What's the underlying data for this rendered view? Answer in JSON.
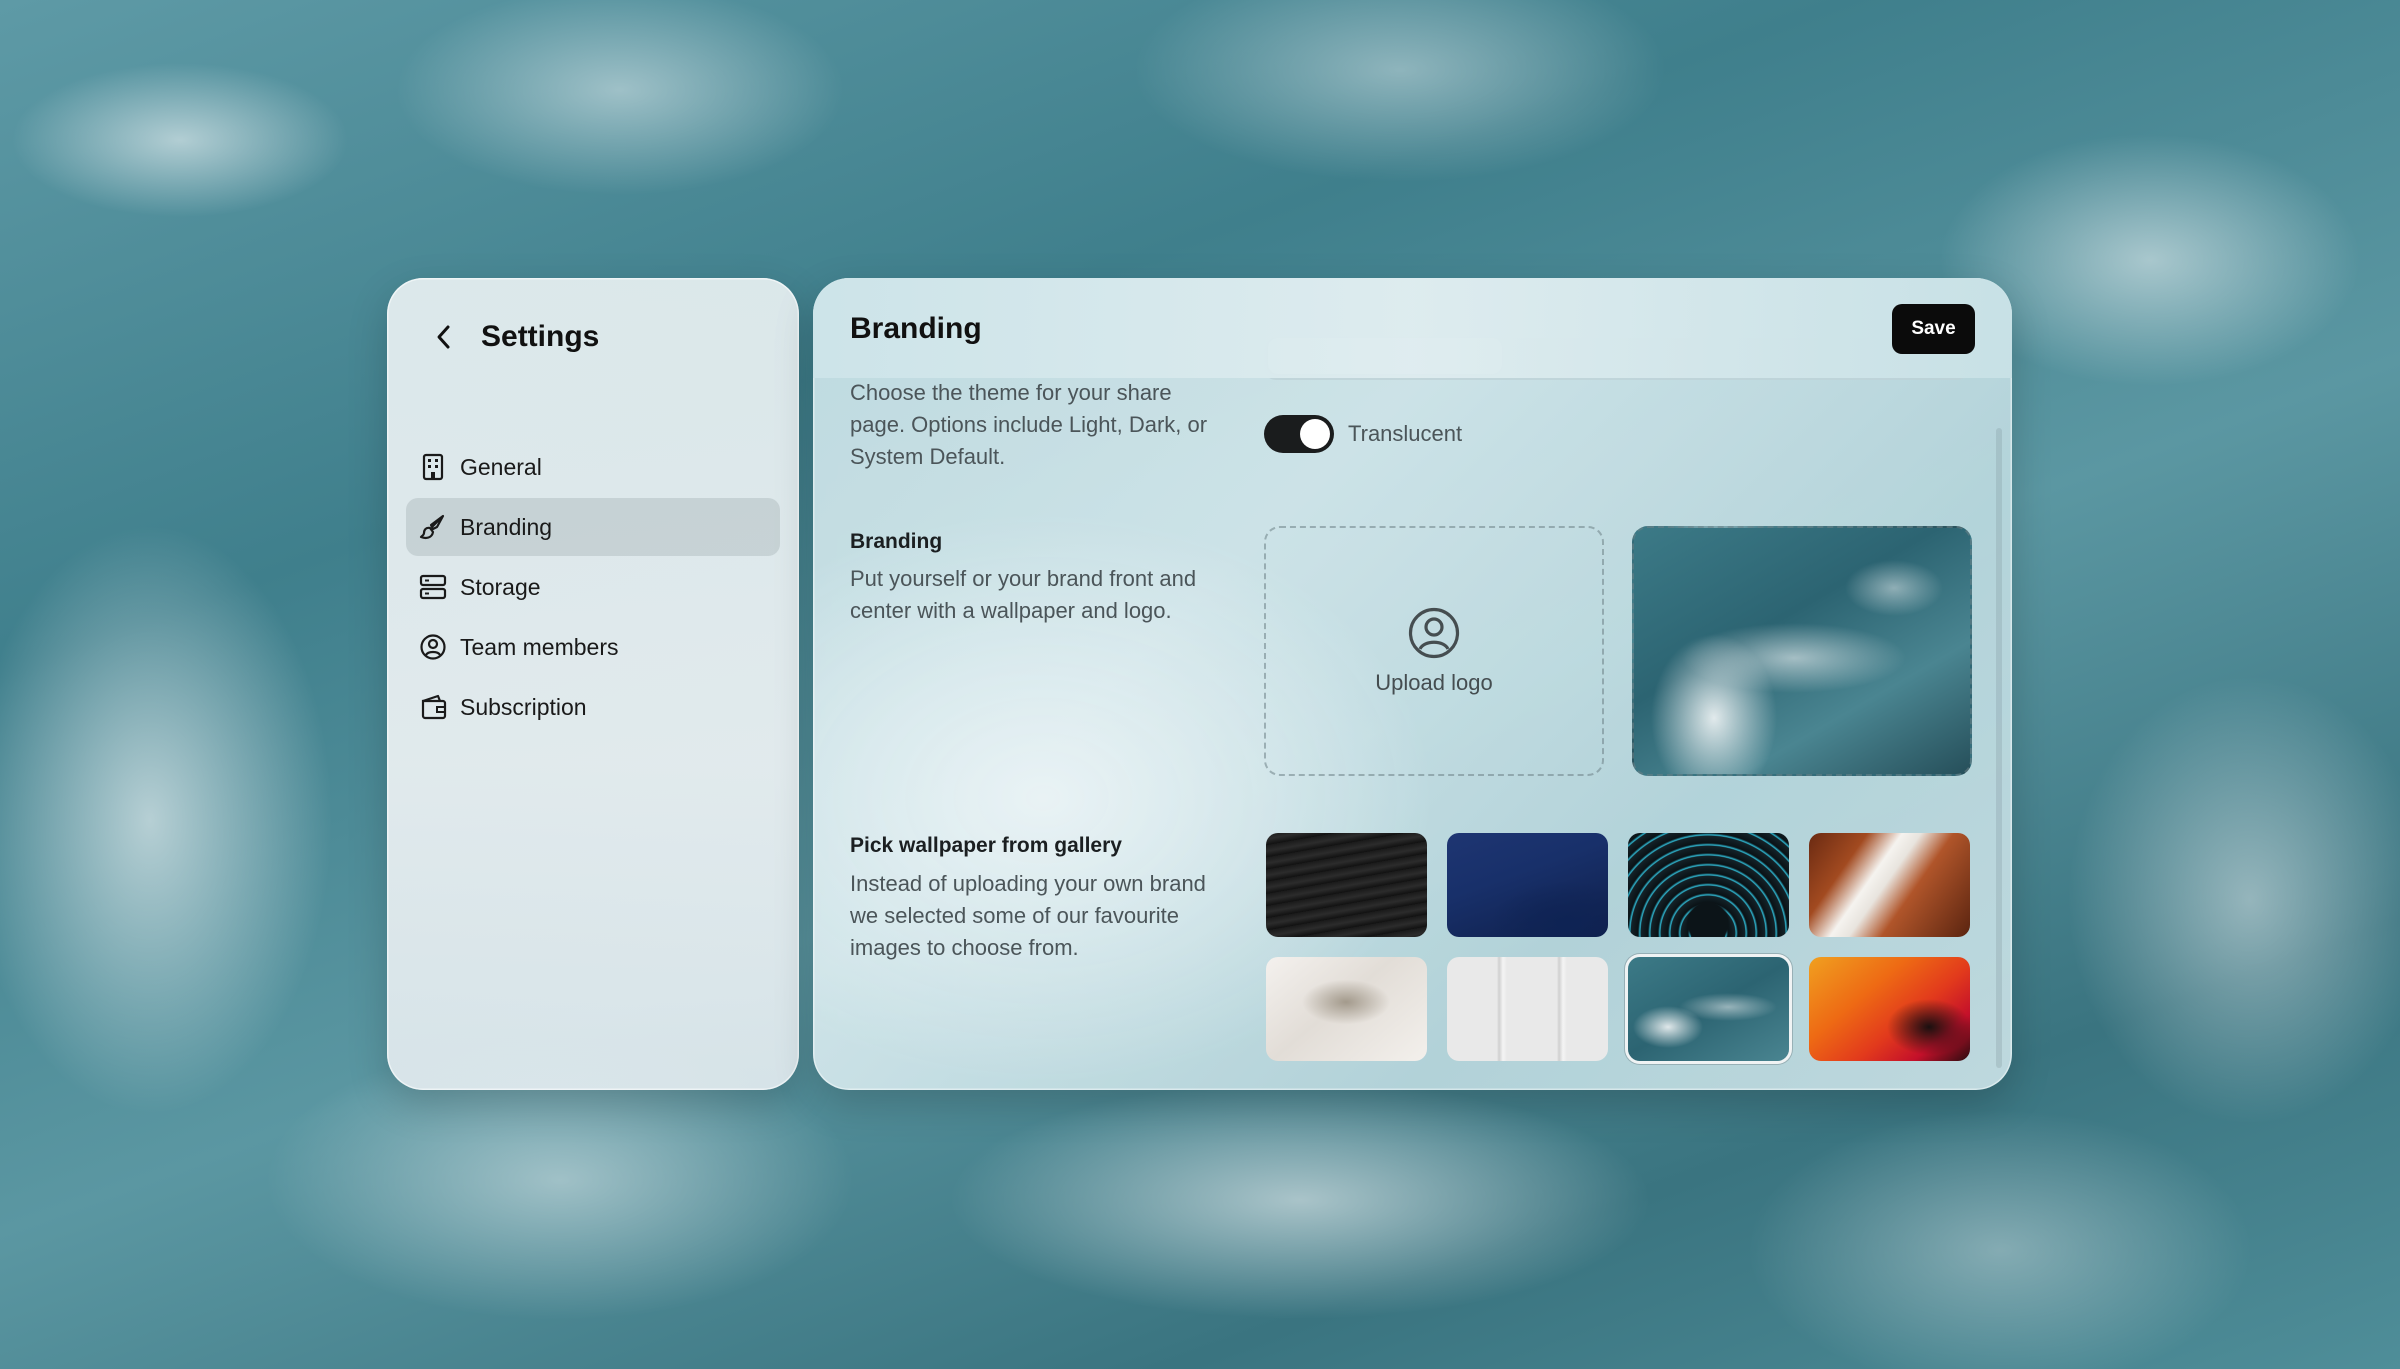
{
  "sidebar": {
    "title": "Settings",
    "items": [
      {
        "label": "General",
        "icon": "building-icon"
      },
      {
        "label": "Branding",
        "icon": "paintbrush-icon",
        "active": true
      },
      {
        "label": "Storage",
        "icon": "server-icon"
      },
      {
        "label": "Team members",
        "icon": "user-circle-icon"
      },
      {
        "label": "Subscription",
        "icon": "wallet-icon"
      }
    ]
  },
  "main": {
    "title": "Branding",
    "save_label": "Save",
    "theme": {
      "description": "Choose the theme for your share page. Options include Light, Dark, or System Default.",
      "toggle_label": "Translucent",
      "toggle_on": true
    },
    "branding": {
      "title": "Branding",
      "description": "Put yourself or your brand front and center with a wallpaper and logo.",
      "upload_label": "Upload logo"
    },
    "gallery": {
      "title": "Pick wallpaper from gallery",
      "description": "Instead of uploading your own brand we selected some of our favourite images to choose from.",
      "selected_index": 6
    }
  }
}
